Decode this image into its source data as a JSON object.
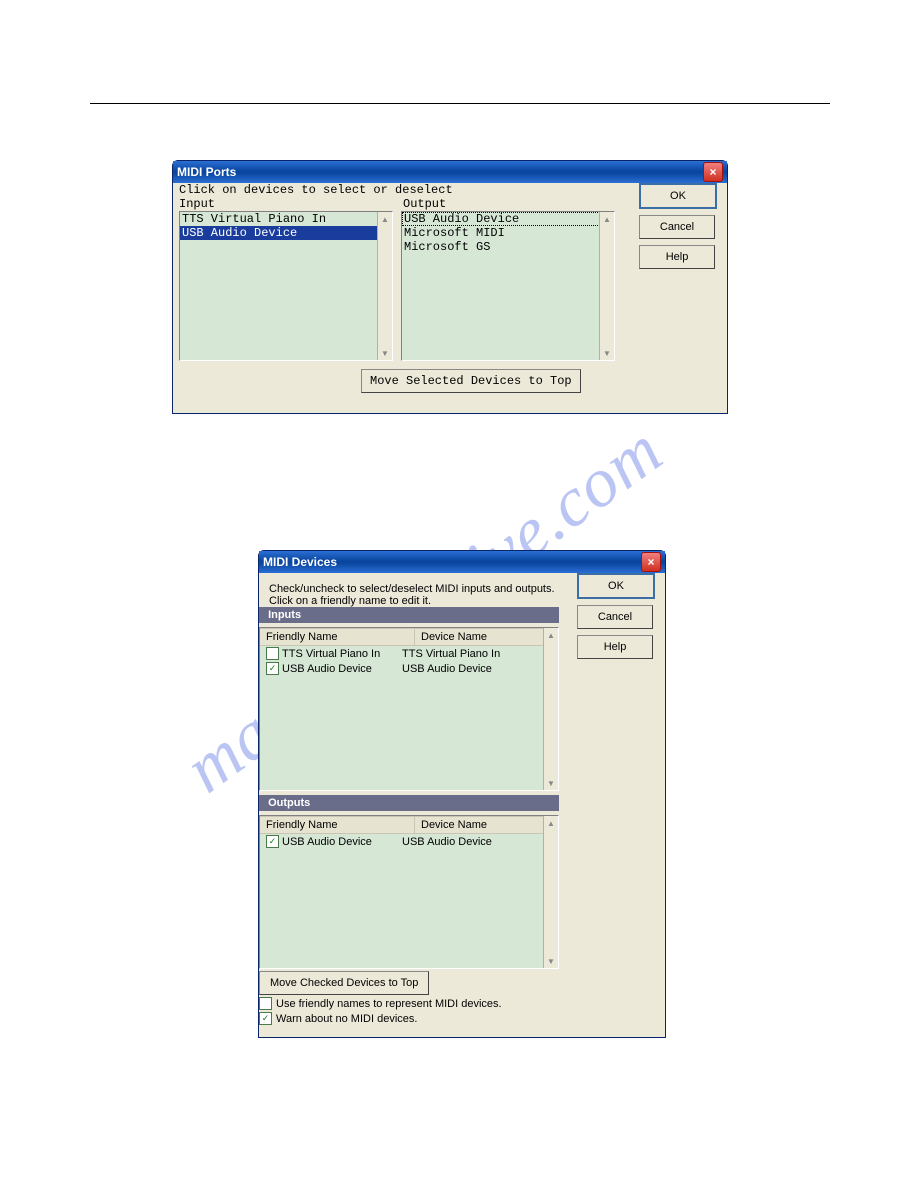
{
  "midiPorts": {
    "title": "MIDI Ports",
    "instruction": "Click on devices to select or deselect",
    "inputLabel": "Input",
    "outputLabel": "Output",
    "inputs": [
      {
        "name": "TTS Virtual Piano In",
        "selected": false
      },
      {
        "name": "USB Audio Device",
        "selected": true
      }
    ],
    "outputs": [
      {
        "name": "USB Audio Device",
        "focused": true
      },
      {
        "name": "Microsoft MIDI",
        "focused": false
      },
      {
        "name": "Microsoft GS",
        "focused": false
      }
    ],
    "buttons": {
      "ok": "OK",
      "cancel": "Cancel",
      "help": "Help"
    },
    "moveBtn": "Move Selected Devices to Top"
  },
  "midiDevices": {
    "title": "MIDI Devices",
    "instruction1": "Check/uncheck to select/deselect MIDI inputs and outputs.",
    "instruction2": "Click on a friendly name to edit it.",
    "inputsLabel": "Inputs",
    "outputsLabel": "Outputs",
    "colFriendly": "Friendly Name",
    "colDevice": "Device Name",
    "inputs": [
      {
        "friendly": "TTS Virtual Piano In",
        "device": "TTS Virtual Piano In",
        "checked": false
      },
      {
        "friendly": "USB Audio Device",
        "device": "USB Audio Device",
        "checked": true
      }
    ],
    "outputs": [
      {
        "friendly": "USB Audio Device",
        "device": "USB Audio Device",
        "checked": true
      }
    ],
    "moveBtn": "Move Checked Devices to Top",
    "optFriendly": "Use friendly names to represent MIDI devices.",
    "optWarn": "Warn about no MIDI devices.",
    "optFriendlyChecked": false,
    "optWarnChecked": true,
    "buttons": {
      "ok": "OK",
      "cancel": "Cancel",
      "help": "Help"
    }
  },
  "watermark": "manualarchive.com"
}
